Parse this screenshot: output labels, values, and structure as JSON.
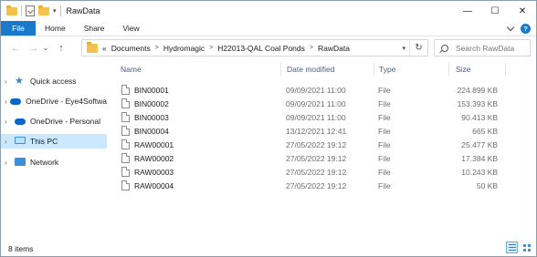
{
  "window": {
    "title": "RawData",
    "controls": {
      "minimize": "—",
      "maximize": "☐",
      "close": "✕"
    }
  },
  "ribbon": {
    "tabs": [
      "File",
      "Home",
      "Share",
      "View"
    ]
  },
  "navigation": {
    "back_glyph": "←",
    "forward_glyph": "→",
    "recent_glyph": "⌄",
    "up_glyph": "↑"
  },
  "address": {
    "overflow_glyph": "«",
    "breadcrumbs": [
      "Documents",
      "Hydromagic",
      "H22013-QAL Coal Ponds",
      "RawData"
    ],
    "refresh_glyph": "↻"
  },
  "search": {
    "placeholder": "Search RawData"
  },
  "sidebar": {
    "items": [
      {
        "label": "Quick access",
        "icon": "star-icon"
      },
      {
        "label": "OneDrive - Eye4Softwa",
        "icon": "cloud-icon"
      },
      {
        "label": "OneDrive - Personal",
        "icon": "cloud-icon"
      },
      {
        "label": "This PC",
        "icon": "computer-icon",
        "selected": true
      },
      {
        "label": "Network",
        "icon": "network-icon"
      }
    ]
  },
  "filelist": {
    "columns": [
      "Name",
      "Date modified",
      "Type",
      "Size"
    ],
    "rows": [
      {
        "name": "BIN00001",
        "date": "09/09/2021 11:00",
        "type": "File",
        "size": "224.899 KB"
      },
      {
        "name": "BIN00002",
        "date": "09/09/2021 11:00",
        "type": "File",
        "size": "153.393 KB"
      },
      {
        "name": "BIN00003",
        "date": "09/09/2021 11:00",
        "type": "File",
        "size": "90.413 KB"
      },
      {
        "name": "BIN00004",
        "date": "13/12/2021 12:41",
        "type": "File",
        "size": "665 KB"
      },
      {
        "name": "RAW00001",
        "date": "27/05/2022 19:12",
        "type": "File",
        "size": "25.477 KB"
      },
      {
        "name": "RAW00002",
        "date": "27/05/2022 19:12",
        "type": "File",
        "size": "17.384 KB"
      },
      {
        "name": "RAW00003",
        "date": "27/05/2022 19:12",
        "type": "File",
        "size": "10.243 KB"
      },
      {
        "name": "RAW00004",
        "date": "27/05/2022 19:12",
        "type": "File",
        "size": "50 KB"
      }
    ]
  },
  "status": {
    "item_count": "8 items"
  },
  "colors": {
    "accent": "#1979ca",
    "selection": "#cce8ff",
    "folder": "#f3c24e"
  }
}
